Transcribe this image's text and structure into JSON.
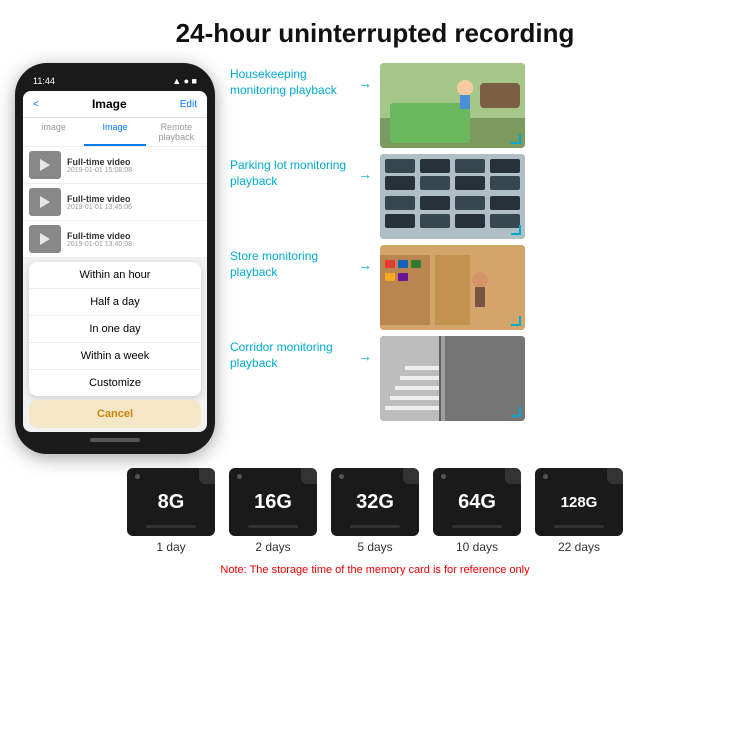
{
  "page": {
    "title": "24-hour uninterrupted recording"
  },
  "phone": {
    "time": "11:44",
    "header": {
      "back": "<",
      "title": "Image",
      "edit": "Edit"
    },
    "tabs": [
      "image",
      "Image",
      "Remote playback"
    ],
    "list_items": [
      {
        "label": "Full-time video",
        "date": "2019-01-01 15:08:08"
      },
      {
        "label": "Full-time video",
        "date": "2019-01-01 13:45:06"
      },
      {
        "label": "Full-time video",
        "date": "2019-01-01 13:40:08"
      }
    ],
    "dropdown": {
      "items": [
        "Within an hour",
        "Half a day",
        "In one day",
        "Within a week",
        "Customize"
      ],
      "cancel": "Cancel"
    }
  },
  "monitoring": [
    {
      "label": "Housekeeping monitoring playback",
      "img_class": "img-housekeeping"
    },
    {
      "label": "Parking lot monitoring playback",
      "img_class": "img-parking"
    },
    {
      "label": "Store monitoring playback",
      "img_class": "img-store"
    },
    {
      "label": "Corridor monitoring playback",
      "img_class": "img-corridor"
    }
  ],
  "storage": {
    "cards": [
      {
        "size": "8G",
        "days": "1 day"
      },
      {
        "size": "16G",
        "days": "2 days"
      },
      {
        "size": "32G",
        "days": "5 days"
      },
      {
        "size": "64G",
        "days": "10 days"
      },
      {
        "size": "128G",
        "days": "22 days"
      }
    ],
    "note": "Note: The storage time of the memory card is for reference only"
  }
}
